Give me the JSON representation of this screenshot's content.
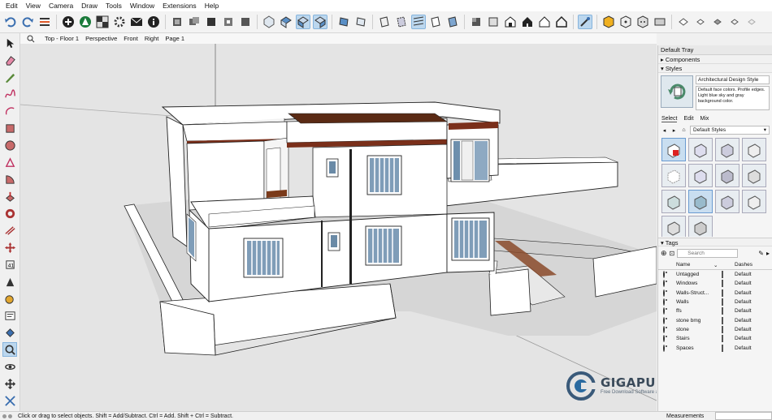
{
  "menu": [
    "Edit",
    "View",
    "Camera",
    "Draw",
    "Tools",
    "Window",
    "Extensions",
    "Help"
  ],
  "scenes": {
    "tabs": [
      "Top - Floor 1",
      "Perspective",
      "Front",
      "Right",
      "Page 1"
    ]
  },
  "tray": {
    "title": "Default Tray",
    "components_label": "Components",
    "styles_label": "Styles",
    "style_name": "Architectural Design Style",
    "style_description": "Default face colors. Profile edges. Light blue sky and gray background color.",
    "style_tabs": [
      "Select",
      "Edit",
      "Mix"
    ],
    "collection": "Default Styles",
    "tags_label": "Tags",
    "tag_search_placeholder": "Search",
    "tag_columns": {
      "name": "Name",
      "dashes": "Dashes"
    },
    "tags": [
      {
        "name": "Untagged",
        "color": "#e8625a",
        "dashes": "Default"
      },
      {
        "name": "Windows",
        "color": "#33404c",
        "dashes": "Default"
      },
      {
        "name": "Walls-Struct...",
        "color": "#33404c",
        "dashes": "Default"
      },
      {
        "name": "Walls",
        "color": "#33404c",
        "dashes": "Default"
      },
      {
        "name": "ffs",
        "color": "#a73b3b",
        "dashes": "Default"
      },
      {
        "name": "stone bmg",
        "color": "#33404c",
        "dashes": "Default"
      },
      {
        "name": "stone",
        "color": "#33404c",
        "dashes": "Default"
      },
      {
        "name": "Stairs",
        "color": "#33404c",
        "dashes": "Default"
      },
      {
        "name": "Spaces",
        "color": "#33404c",
        "dashes": "Default"
      }
    ]
  },
  "status": {
    "hint": "Click or drag to select objects. Shift = Add/Subtract. Ctrl = Add. Shift + Ctrl = Subtract.",
    "measurements_label": "Measurements"
  },
  "watermark": {
    "brand": "GIGAPURBALINGGA",
    "tagline": "Free Download Software & Games Full Version"
  },
  "colors": {
    "accent": "#86b4dd",
    "ground": "#e4e4e4",
    "wall": "#ffffff",
    "wood": "#8a4a2a"
  }
}
